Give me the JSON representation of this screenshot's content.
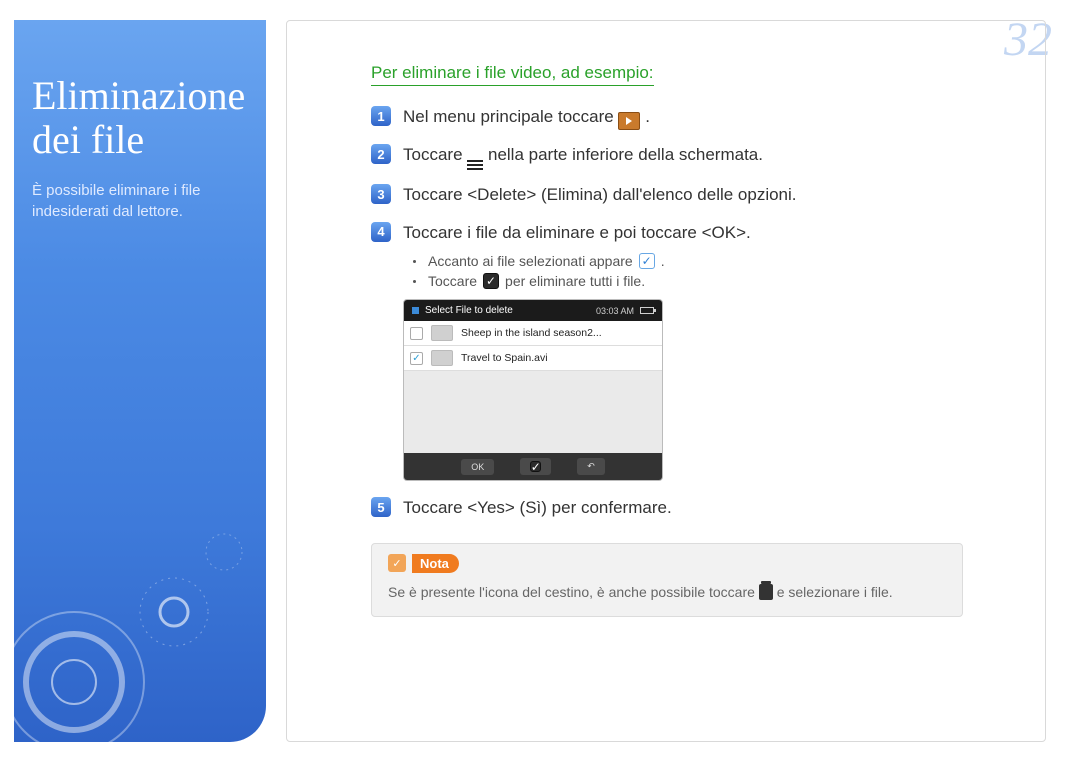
{
  "page_number": "32",
  "sidebar": {
    "title_line1": "Eliminazione",
    "title_line2": "dei file",
    "subtitle": "È possibile eliminare i file indesiderati dal lettore."
  },
  "section": {
    "heading": "Per eliminare i file video, ad esempio:"
  },
  "steps": {
    "s1_pre": "Nel menu principale toccare ",
    "s1_post": ".",
    "s2_pre": "Toccare ",
    "s2_post": " nella parte inferiore della schermata.",
    "s3": "Toccare <Delete> (Elimina) dall'elenco delle opzioni.",
    "s4": "Toccare i file da eliminare e poi toccare  <OK>.",
    "s5": "Toccare <Yes> (Sì) per confermare."
  },
  "sub": {
    "a_pre": "Accanto ai file selezionati appare ",
    "a_post": ".",
    "b_pre": "Toccare ",
    "b_post": " per eliminare tutti i file."
  },
  "device": {
    "title": "Select File to delete",
    "time": "03:03 AM",
    "rows": [
      {
        "checked": false,
        "label": "Sheep in the island season2..."
      },
      {
        "checked": true,
        "label": "Travel to Spain.avi"
      }
    ],
    "ok": "OK"
  },
  "note": {
    "label": "Nota",
    "text_pre": "Se è presente l'icona del cestino, è anche possibile toccare ",
    "text_post": " e selezionare i file."
  }
}
